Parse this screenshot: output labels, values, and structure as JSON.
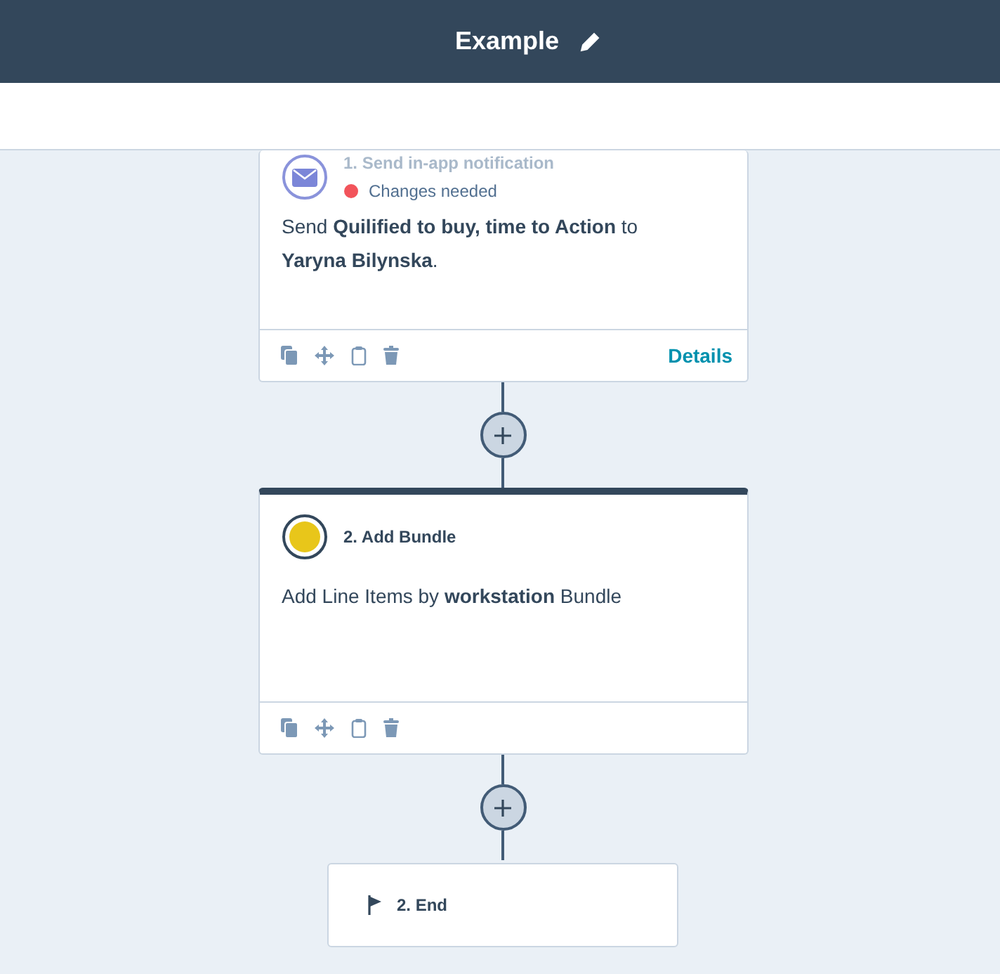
{
  "header": {
    "title": "Example"
  },
  "steps": [
    {
      "kind": "notification",
      "title": "1. Send in-app notification",
      "status": {
        "text": "Changes needed",
        "color": "#f2545b"
      },
      "selected": false,
      "description": "Send **Quilified to buy, time to Action** to **Yaryna Bilynska**.",
      "details": "Details"
    },
    {
      "kind": "bundle",
      "title": "2. Add Bundle",
      "selected": true,
      "description": "Add Line Items by **workstation** Bundle"
    },
    {
      "kind": "end",
      "title": "2. End"
    }
  ]
}
